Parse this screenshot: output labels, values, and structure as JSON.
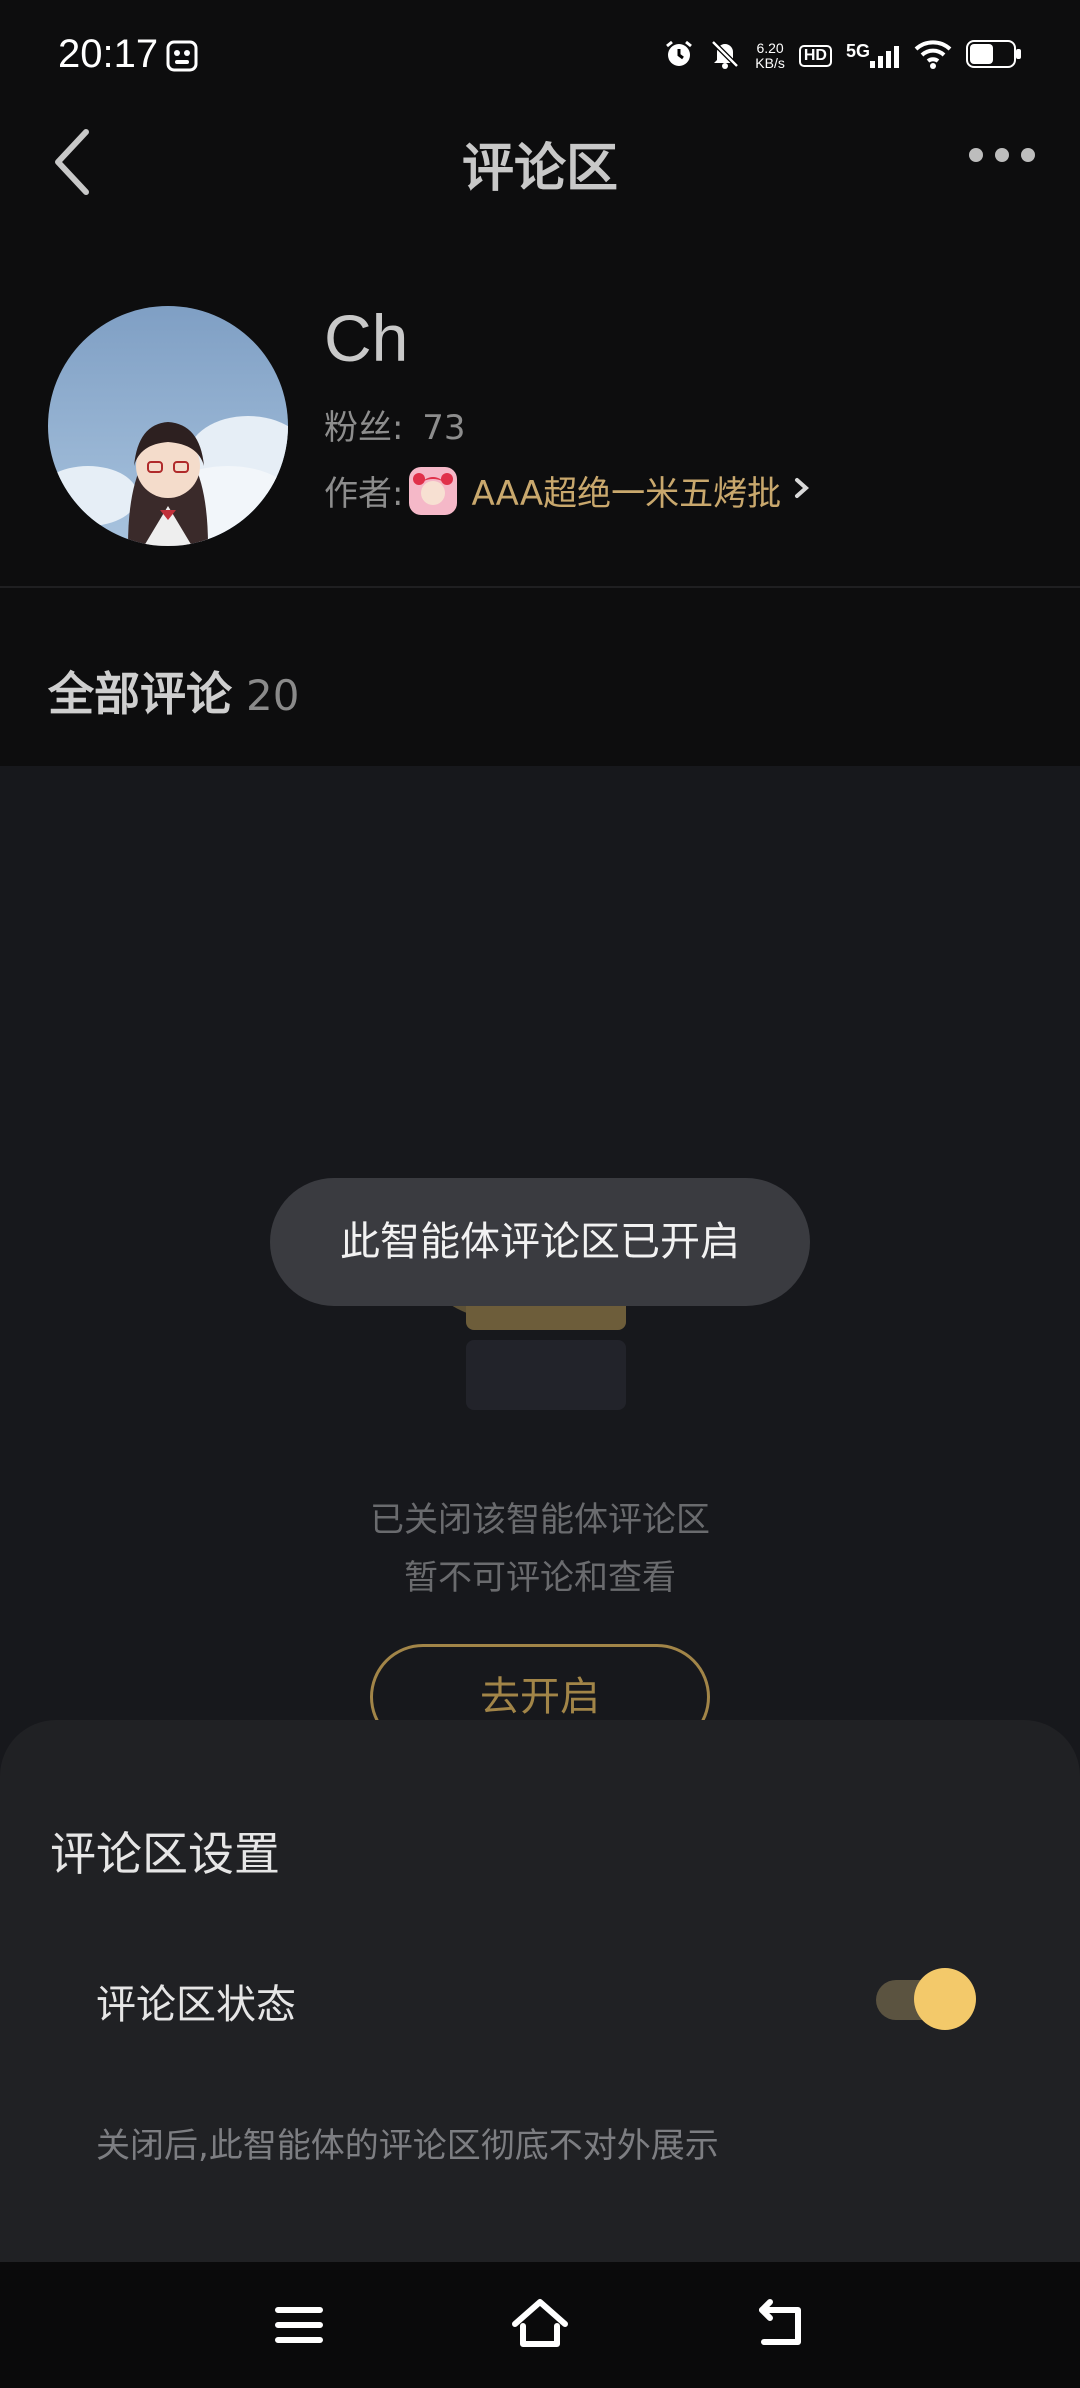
{
  "status_bar": {
    "time": "20:17",
    "net_speed_value": "6.20",
    "net_speed_unit": "KB/s",
    "hd_label": "HD",
    "network_label": "5G",
    "battery_level": 0.55
  },
  "header": {
    "title": "评论区"
  },
  "profile": {
    "name": "Ch",
    "fans_label": "粉丝:",
    "fans_value": "73",
    "author_label": "作者:",
    "author_name": "AAA超绝一米五烤批"
  },
  "comments": {
    "section_title": "全部评论",
    "count": "20"
  },
  "empty_state": {
    "line1": "已关闭该智能体评论区",
    "line2": "暂不可评论和查看",
    "enable_button": "去开启"
  },
  "toast": {
    "message": "此智能体评论区已开启"
  },
  "sheet": {
    "title": "评论区设置",
    "status_label": "评论区状态",
    "toggle_on": true,
    "description": "关闭后,此智能体的评论区彻底不对外展示"
  },
  "colors": {
    "accent_gold": "#c9a86d",
    "toggle_knob": "#f3c96a",
    "background": "#0d0d0e",
    "sheet_bg": "#202124"
  },
  "icons": {
    "back": "chevron-left-icon",
    "more": "more-horizontal-icon",
    "nav_menu": "menu-icon",
    "nav_home": "home-icon",
    "nav_back": "return-icon"
  }
}
